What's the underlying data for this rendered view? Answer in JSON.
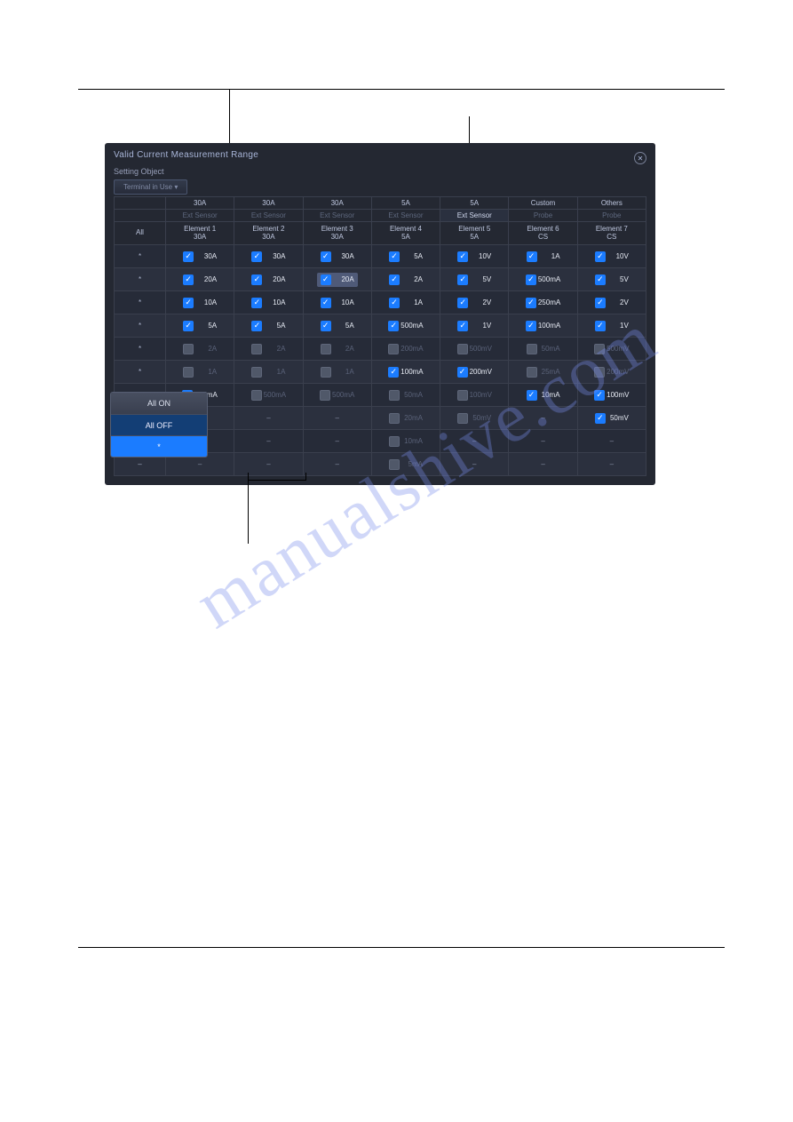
{
  "watermark": "manualshive.com",
  "dialog": {
    "title": "Valid Current Measurement Range",
    "subtitle": "Setting Object",
    "dropdown": "Terminal in Use ▾",
    "close_icon_glyph": "✕"
  },
  "context_menu": {
    "items": [
      "All ON",
      "All OFF",
      "*"
    ]
  },
  "top_headers": [
    "30A",
    "30A",
    "30A",
    "5A",
    "5A",
    "Custom",
    "Others"
  ],
  "sub_headers": [
    "Ext Sensor",
    "Ext Sensor",
    "Ext Sensor",
    "Ext Sensor",
    "Ext Sensor",
    "Probe",
    "Probe"
  ],
  "sub_headers_active": [
    false,
    false,
    false,
    false,
    true,
    false,
    false
  ],
  "col_all": "All",
  "col_headers": [
    {
      "l1": "Element 1",
      "l2": "30A"
    },
    {
      "l1": "Element 2",
      "l2": "30A"
    },
    {
      "l1": "Element 3",
      "l2": "30A"
    },
    {
      "l1": "Element 4",
      "l2": "5A"
    },
    {
      "l1": "Element 5",
      "l2": "5A"
    },
    {
      "l1": "Element 6",
      "l2": "CS"
    },
    {
      "l1": "Element 7",
      "l2": "CS"
    }
  ],
  "rows": [
    {
      "all": "*",
      "c": [
        {
          "t": "chk",
          "on": true,
          "v": "30A"
        },
        {
          "t": "chk",
          "on": true,
          "v": "30A"
        },
        {
          "t": "chk",
          "on": true,
          "v": "30A"
        },
        {
          "t": "chk",
          "on": true,
          "v": "5A"
        },
        {
          "t": "chk",
          "on": true,
          "v": "10V"
        },
        {
          "t": "chk",
          "on": true,
          "v": "1A"
        },
        {
          "t": "chk",
          "on": true,
          "v": "10V"
        }
      ]
    },
    {
      "all": "*",
      "c": [
        {
          "t": "chk",
          "on": true,
          "v": "20A"
        },
        {
          "t": "chk",
          "on": true,
          "v": "20A"
        },
        {
          "t": "hchk",
          "on": true,
          "v": "20A"
        },
        {
          "t": "chk",
          "on": true,
          "v": "2A"
        },
        {
          "t": "chk",
          "on": true,
          "v": "5V"
        },
        {
          "t": "chk",
          "on": true,
          "v": "500mA"
        },
        {
          "t": "chk",
          "on": true,
          "v": "5V"
        }
      ]
    },
    {
      "all": "*",
      "c": [
        {
          "t": "chk",
          "on": true,
          "v": "10A"
        },
        {
          "t": "chk",
          "on": true,
          "v": "10A"
        },
        {
          "t": "chk",
          "on": true,
          "v": "10A"
        },
        {
          "t": "chk",
          "on": true,
          "v": "1A"
        },
        {
          "t": "chk",
          "on": true,
          "v": "2V"
        },
        {
          "t": "chk",
          "on": true,
          "v": "250mA"
        },
        {
          "t": "chk",
          "on": true,
          "v": "2V"
        }
      ]
    },
    {
      "all": "*",
      "c": [
        {
          "t": "chk",
          "on": true,
          "v": "5A"
        },
        {
          "t": "chk",
          "on": true,
          "v": "5A"
        },
        {
          "t": "chk",
          "on": true,
          "v": "5A"
        },
        {
          "t": "chk",
          "on": true,
          "v": "500mA"
        },
        {
          "t": "chk",
          "on": true,
          "v": "1V"
        },
        {
          "t": "chk",
          "on": true,
          "v": "100mA"
        },
        {
          "t": "chk",
          "on": true,
          "v": "1V"
        }
      ]
    },
    {
      "all": "*",
      "c": [
        {
          "t": "chk",
          "on": false,
          "v": "2A"
        },
        {
          "t": "chk",
          "on": false,
          "v": "2A"
        },
        {
          "t": "chk",
          "on": false,
          "v": "2A"
        },
        {
          "t": "chk",
          "on": false,
          "v": "200mA"
        },
        {
          "t": "chk",
          "on": false,
          "v": "500mV"
        },
        {
          "t": "chk",
          "on": false,
          "v": "50mA"
        },
        {
          "t": "chk",
          "on": false,
          "v": "500mV"
        }
      ]
    },
    {
      "all": "*",
      "c": [
        {
          "t": "chk",
          "on": false,
          "v": "1A"
        },
        {
          "t": "chk",
          "on": false,
          "v": "1A"
        },
        {
          "t": "chk",
          "on": false,
          "v": "1A"
        },
        {
          "t": "chk",
          "on": true,
          "v": "100mA"
        },
        {
          "t": "chk",
          "on": true,
          "v": "200mV"
        },
        {
          "t": "chk",
          "on": false,
          "v": "25mA"
        },
        {
          "t": "chk",
          "on": false,
          "v": "200mV"
        }
      ]
    },
    {
      "all": "*",
      "c": [
        {
          "t": "chk",
          "on": true,
          "v": "500mA"
        },
        {
          "t": "chk",
          "on": false,
          "v": "500mA"
        },
        {
          "t": "chk",
          "on": false,
          "v": "500mA"
        },
        {
          "t": "chk",
          "on": false,
          "v": "50mA"
        },
        {
          "t": "chk",
          "on": false,
          "v": "100mV"
        },
        {
          "t": "chk",
          "on": true,
          "v": "10mA"
        },
        {
          "t": "chk",
          "on": true,
          "v": "100mV"
        }
      ]
    },
    {
      "all": "–",
      "c": [
        {
          "t": "dash"
        },
        {
          "t": "dash"
        },
        {
          "t": "dash"
        },
        {
          "t": "chk",
          "on": false,
          "v": "20mA"
        },
        {
          "t": "chk",
          "on": false,
          "v": "50mV"
        },
        {
          "t": "dash"
        },
        {
          "t": "chk",
          "on": true,
          "v": "50mV"
        }
      ]
    },
    {
      "all": "–",
      "c": [
        {
          "t": "dash"
        },
        {
          "t": "dash"
        },
        {
          "t": "dash"
        },
        {
          "t": "chk",
          "on": false,
          "v": "10mA"
        },
        {
          "t": "dash"
        },
        {
          "t": "dash"
        },
        {
          "t": "dash"
        }
      ]
    },
    {
      "all": "–",
      "c": [
        {
          "t": "dash"
        },
        {
          "t": "dash"
        },
        {
          "t": "dash"
        },
        {
          "t": "chk",
          "on": false,
          "v": "5mA"
        },
        {
          "t": "dash"
        },
        {
          "t": "dash"
        },
        {
          "t": "dash"
        }
      ]
    }
  ]
}
